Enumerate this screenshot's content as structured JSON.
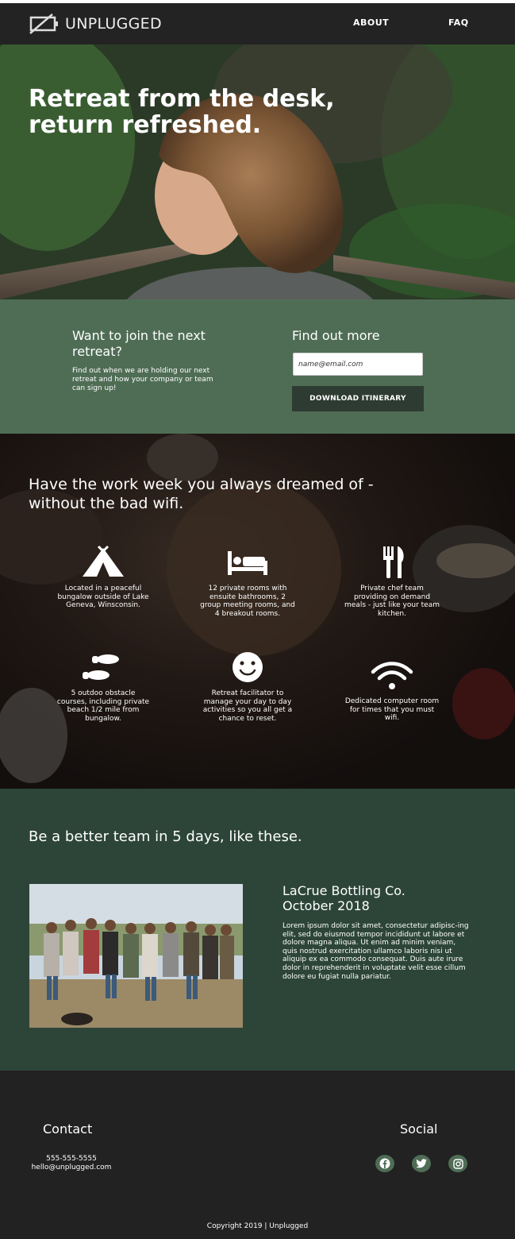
{
  "header": {
    "brand": "UNPLUGGED",
    "nav": [
      {
        "label": "ABOUT"
      },
      {
        "label": "FAQ"
      }
    ]
  },
  "hero": {
    "title": "Retreat from the desk, return refreshed."
  },
  "signup": {
    "heading": "Want to join the next retreat?",
    "description": "Find out when we are holding our next retreat and how your company or team can sign up!",
    "more_heading": "Find out more",
    "email_placeholder": "name@email.com",
    "button_label": "DOWNLOAD ITINERARY"
  },
  "features": {
    "title": "Have the work week you always dreamed of - without the bad wifi.",
    "items": [
      {
        "icon": "tent-icon",
        "text": "Located in a peaceful bungalow outside of Lake Geneva, Winsconsin."
      },
      {
        "icon": "bed-icon",
        "text": "12 private rooms with ensuite bathrooms, 2 group meeting rooms, and 4 breakout rooms."
      },
      {
        "icon": "utensils-icon",
        "text": "Private chef team providing on demand meals - just like your team kitchen."
      },
      {
        "icon": "shoe-prints-icon",
        "text": "5 outdoo obstacle courses, including private beach 1/2 mile from bungalow."
      },
      {
        "icon": "smile-icon",
        "text": "Retreat facilitator to manage your day to day activities so you all get a chance to reset."
      },
      {
        "icon": "wifi-icon",
        "text": "Dedicated computer room for times that you must wifi."
      }
    ]
  },
  "team": {
    "title": "Be a better team in 5 days, like these.",
    "case_title": "LaCrue Bottling Co. October 2018",
    "case_text": "Lorem ipsum dolor sit amet, consectetur adipisc-ing elit, sed do eiusmod tempor incididunt ut labore et dolore magna aliqua. Ut enim ad minim veniam, quis nostrud exercitation ullamco laboris nisi ut aliquip ex ea commodo consequat. Duis aute irure dolor in reprehenderit in voluptate velit esse cillum dolore eu fugiat nulla pariatur."
  },
  "footer": {
    "contact_heading": "Contact",
    "phone": "555-555-5555",
    "email": "hello@unplugged.com",
    "social_heading": "Social",
    "social": [
      "facebook-icon",
      "twitter-icon",
      "instagram-icon"
    ],
    "copyright": "Copyright 2019 | Unplugged"
  },
  "colors": {
    "header_bg": "#222322",
    "signup_bg": "#4f6d55",
    "button_bg": "#2e3b32",
    "team_bg": "#2d4539",
    "footer_bg": "#222222",
    "social_bg": "#4f6d55"
  }
}
